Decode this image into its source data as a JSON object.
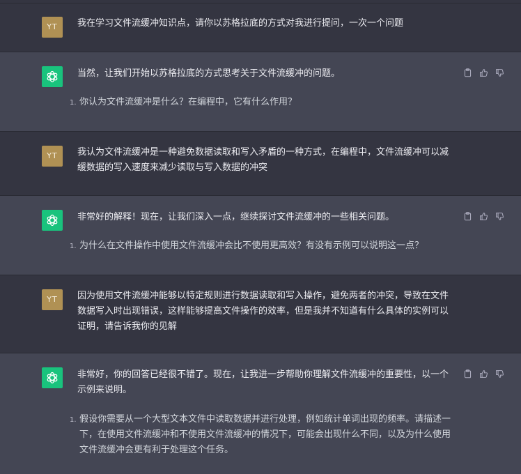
{
  "user_initials": "YT",
  "colors": {
    "user_bg": "#343541",
    "bot_bg": "#444654",
    "avatar_user": "#b09154",
    "avatar_bot": "#19c37d"
  },
  "icons": {
    "copy": "clipboard-icon",
    "like": "thumbs-up-icon",
    "dislike": "thumbs-down-icon"
  },
  "conversation": [
    {
      "role": "user",
      "text": "我在学习文件流缓冲知识点，请你以苏格拉底的方式对我进行提问，一次一个问题"
    },
    {
      "role": "assistant",
      "text": "当然，让我们开始以苏格拉底的方式思考关于文件流缓冲的问题。",
      "list_num": "1.",
      "list_text": "你认为文件流缓冲是什么？在编程中，它有什么作用？"
    },
    {
      "role": "user",
      "text": "我认为文件流缓冲是一种避免数据读取和写入矛盾的一种方式，在编程中，文件流缓冲可以减缓数据的写入速度来减少读取与写入数据的冲突"
    },
    {
      "role": "assistant",
      "text": "非常好的解释！现在，让我们深入一点，继续探讨文件流缓冲的一些相关问题。",
      "list_num": "1.",
      "list_text": "为什么在文件操作中使用文件流缓冲会比不使用更高效？有没有示例可以说明这一点？"
    },
    {
      "role": "user",
      "text": "因为使用文件流缓冲能够以特定规则进行数据读取和写入操作，避免两者的冲突，导致在文件数据写入时出现错误，这样能够提高文件操作的效率，但是我并不知道有什么具体的实例可以证明，请告诉我你的见解"
    },
    {
      "role": "assistant",
      "text": "非常好，你的回答已经很不错了。现在，让我进一步帮助你理解文件流缓冲的重要性，以一个示例来说明。",
      "list_num": "1.",
      "list_text": "假设你需要从一个大型文本文件中读取数据并进行处理，例如统计单词出现的频率。请描述一下，在使用文件流缓冲和不使用文件流缓冲的情况下，可能会出现什么不同，以及为什么使用文件流缓冲会更有利于处理这个任务。"
    }
  ]
}
